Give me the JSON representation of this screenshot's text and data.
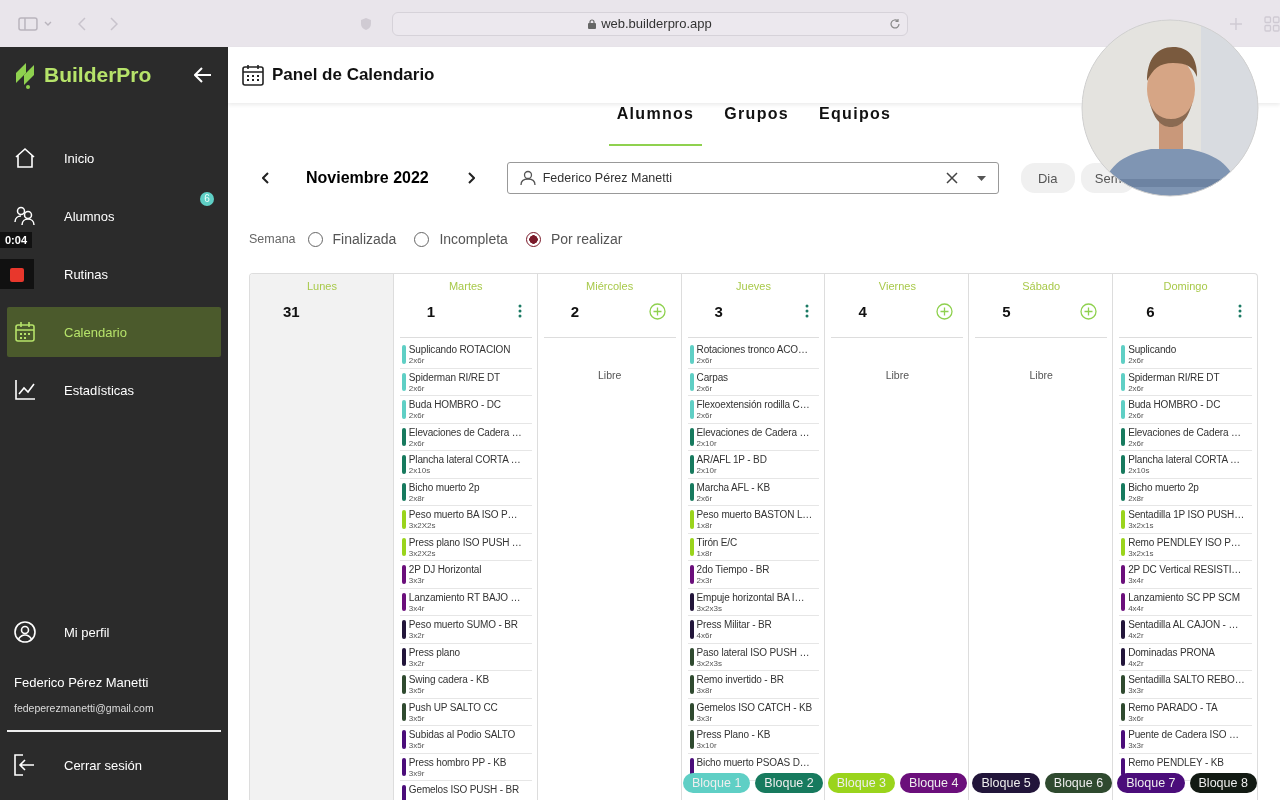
{
  "browser": {
    "url": "web.builderpro.app"
  },
  "sidebar": {
    "brand": "BuilderPro",
    "items": [
      {
        "label": "Inicio",
        "selected": false
      },
      {
        "label": "Alumnos",
        "selected": false,
        "badge": "6"
      },
      {
        "label": "Rutinas",
        "selected": false
      },
      {
        "label": "Calendario",
        "selected": true
      },
      {
        "label": "Estadísticas",
        "selected": false
      }
    ],
    "profile": {
      "label": "Mi perfil",
      "name": "Federico Pérez Manetti",
      "email": "fedeperezmanetti@gmail.com"
    },
    "logout": "Cerrar sesión"
  },
  "video_overlay": {
    "time": "0:04"
  },
  "header": {
    "title": "Panel de Calendario"
  },
  "tabs": [
    {
      "label": "Alumnos",
      "selected": true
    },
    {
      "label": "Grupos",
      "selected": false
    },
    {
      "label": "Equipos",
      "selected": false
    }
  ],
  "month": "Noviembre 2022",
  "student_field": {
    "value": "Federico Pérez Manetti"
  },
  "view_buttons": [
    {
      "label": "Dia",
      "selected": false
    },
    {
      "label": "Sem",
      "selected": false
    }
  ],
  "filter": {
    "label": "Semana",
    "options": [
      {
        "label": "Finalizada",
        "selected": false
      },
      {
        "label": "Incompleta",
        "selected": false
      },
      {
        "label": "Por realizar",
        "selected": true
      }
    ]
  },
  "days": [
    {
      "name": "Lunes",
      "number": "31",
      "kind": "past"
    },
    {
      "name": "Martes",
      "number": "1",
      "kind": "planned",
      "exercises": [
        {
          "name": "Suplicando ROTACION",
          "reps": "2x6r",
          "color": "#5fcfc5"
        },
        {
          "name": "Spiderman RI/RE DT",
          "reps": "2x6r",
          "color": "#5fcfc5"
        },
        {
          "name": "Buda HOMBRO - DC",
          "reps": "2x6r",
          "color": "#5fcfc5"
        },
        {
          "name": "Elevaciones de Cadera …",
          "reps": "2x6r",
          "color": "#177a5e"
        },
        {
          "name": "Plancha lateral CORTA …",
          "reps": "2x10s",
          "color": "#177a5e"
        },
        {
          "name": "Bicho muerto 2p",
          "reps": "2x8r",
          "color": "#177a5e"
        },
        {
          "name": "Peso muerto BA ISO P…",
          "reps": "3x2X2s",
          "color": "#9ad41c"
        },
        {
          "name": "Press plano ISO PUSH …",
          "reps": "3x2X2s",
          "color": "#9ad41c"
        },
        {
          "name": "2P DJ Horizontal",
          "reps": "3x3r",
          "color": "#6b0f7b"
        },
        {
          "name": "Lanzamiento RT BAJO …",
          "reps": "3x4r",
          "color": "#6b0f7b"
        },
        {
          "name": "Peso muerto SUMO - BR",
          "reps": "3x2r",
          "color": "#22153a"
        },
        {
          "name": "Press plano",
          "reps": "3x2r",
          "color": "#22153a"
        },
        {
          "name": "Swing cadera - KB",
          "reps": "3x5r",
          "color": "#2f4a2f"
        },
        {
          "name": "Push UP SALTO CC",
          "reps": "3x5r",
          "color": "#2f4a2f"
        },
        {
          "name": "Subidas al Podio SALTO",
          "reps": "3x5r",
          "color": "#4b0d7a"
        },
        {
          "name": "Press hombro PP - KB",
          "reps": "3x9r",
          "color": "#4b0d7a"
        },
        {
          "name": "Gemelos ISO PUSH - BR",
          "color": "#4b0d7a"
        }
      ]
    },
    {
      "name": "Miércoles",
      "number": "2",
      "kind": "free",
      "note": "Libre"
    },
    {
      "name": "Jueves",
      "number": "3",
      "kind": "planned",
      "exercises": [
        {
          "name": "Rotaciones tronco ACO…",
          "reps": "2x6r",
          "color": "#5fcfc5"
        },
        {
          "name": "Carpas",
          "reps": "2x6r",
          "color": "#5fcfc5"
        },
        {
          "name": "Flexoextensión rodilla C…",
          "reps": "2x6r",
          "color": "#5fcfc5"
        },
        {
          "name": "Elevaciones de Cadera …",
          "reps": "2x10r",
          "color": "#177a5e"
        },
        {
          "name": "AR/AFL 1P - BD",
          "reps": "2x10r",
          "color": "#177a5e"
        },
        {
          "name": "Marcha AFL - KB",
          "reps": "2x6r",
          "color": "#177a5e"
        },
        {
          "name": "Peso muerto BASTON L…",
          "reps": "1x8r",
          "color": "#9ad41c"
        },
        {
          "name": "Tirón E/C",
          "reps": "1x8r",
          "color": "#9ad41c"
        },
        {
          "name": "2do Tiempo - BR",
          "reps": "2x3r",
          "color": "#6b0f7b"
        },
        {
          "name": "Empuje horizontal BA I…",
          "reps": "3x2x3s",
          "color": "#22153a"
        },
        {
          "name": "Press Militar - BR",
          "reps": "4x6r",
          "color": "#22153a"
        },
        {
          "name": "Paso lateral ISO PUSH …",
          "reps": "3x2x3s",
          "color": "#2f4a2f"
        },
        {
          "name": "Remo invertido - BR",
          "reps": "3x8r",
          "color": "#2f4a2f"
        },
        {
          "name": "Gemelos ISO CATCH - KB",
          "reps": "3x3r",
          "color": "#2f4a2f"
        },
        {
          "name": "Press Plano - KB",
          "reps": "3x10r",
          "color": "#2f4a2f"
        },
        {
          "name": "Bicho muerto PSOAS D…",
          "color": "#4b0d7a"
        }
      ]
    },
    {
      "name": "Viernes",
      "number": "4",
      "kind": "free",
      "note": "Libre"
    },
    {
      "name": "Sábado",
      "number": "5",
      "kind": "free",
      "note": "Libre"
    },
    {
      "name": "Domingo",
      "number": "6",
      "kind": "planned",
      "exercises": [
        {
          "name": "Suplicando",
          "reps": "2x6r",
          "color": "#5fcfc5"
        },
        {
          "name": "Spiderman RI/RE DT",
          "reps": "2x6r",
          "color": "#5fcfc5"
        },
        {
          "name": "Buda HOMBRO - DC",
          "reps": "2x6r",
          "color": "#5fcfc5"
        },
        {
          "name": "Elevaciones de Cadera …",
          "reps": "2x6r",
          "color": "#177a5e"
        },
        {
          "name": "Plancha lateral CORTA …",
          "reps": "2x10s",
          "color": "#177a5e"
        },
        {
          "name": "Bicho muerto 2p",
          "reps": "2x8r",
          "color": "#177a5e"
        },
        {
          "name": "Sentadilla 1P ISO PUSH…",
          "reps": "3x2x1s",
          "color": "#9ad41c"
        },
        {
          "name": "Remo PENDLEY ISO P…",
          "reps": "3x2x1s",
          "color": "#9ad41c"
        },
        {
          "name": "2P DC Vertical RESISTI…",
          "reps": "3x4r",
          "color": "#6b0f7b"
        },
        {
          "name": "Lanzamiento SC PP SCM",
          "reps": "4x4r",
          "color": "#6b0f7b"
        },
        {
          "name": "Sentadilla AL CAJON - …",
          "reps": "4x2r",
          "color": "#22153a"
        },
        {
          "name": "Dominadas PRONA",
          "reps": "4x2r",
          "color": "#22153a"
        },
        {
          "name": "Sentadilla SALTO REBO…",
          "reps": "3x3r",
          "color": "#2f4a2f"
        },
        {
          "name": "Remo PARADO - TA",
          "reps": "3x6r",
          "color": "#2f4a2f"
        },
        {
          "name": "Puente de Cadera ISO …",
          "reps": "3x3r",
          "color": "#4b0d7a"
        },
        {
          "name": "Remo PENDLEY - KB",
          "color": "#4b0d7a"
        }
      ]
    }
  ],
  "blocks": [
    {
      "label": "Bloque 1",
      "color": "#5fcfc5"
    },
    {
      "label": "Bloque 2",
      "color": "#177a5e"
    },
    {
      "label": "Bloque 3",
      "color": "#9ad41c"
    },
    {
      "label": "Bloque 4",
      "color": "#6b0f7b"
    },
    {
      "label": "Bloque 5",
      "color": "#22153a"
    },
    {
      "label": "Bloque 6",
      "color": "#2f4a2f"
    },
    {
      "label": "Bloque 7",
      "color": "#4b0d7a"
    },
    {
      "label": "Bloque 8",
      "color": "#121a13"
    }
  ]
}
